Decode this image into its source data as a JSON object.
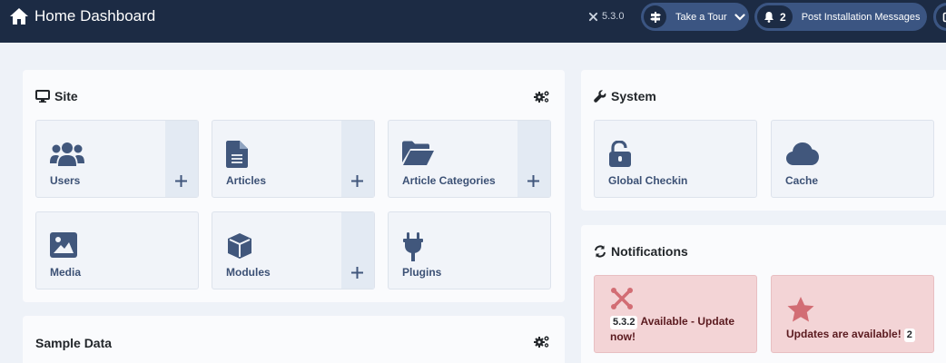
{
  "header": {
    "title": "Home Dashboard",
    "version": "5.3.0",
    "tour_label": "Take a Tour",
    "messages_count": "2",
    "messages_label": "Post Installation Messages"
  },
  "site": {
    "title": "Site",
    "tiles": [
      {
        "label": "Users",
        "icon": "users-icon",
        "has_add": true
      },
      {
        "label": "Articles",
        "icon": "file-icon",
        "has_add": true
      },
      {
        "label": "Article Categories",
        "icon": "folder-open-icon",
        "has_add": true
      },
      {
        "label": "Media",
        "icon": "image-icon",
        "has_add": false
      },
      {
        "label": "Modules",
        "icon": "cube-icon",
        "has_add": true
      },
      {
        "label": "Plugins",
        "icon": "plug-icon",
        "has_add": false
      }
    ]
  },
  "system": {
    "title": "System",
    "tiles": [
      {
        "label": "Global Checkin",
        "icon": "unlock-icon"
      },
      {
        "label": "Cache",
        "icon": "cloud-icon"
      }
    ]
  },
  "notifications": {
    "title": "Notifications",
    "joomla_version": "5.3.2",
    "joomla_text": "Available - Update now!",
    "updates_text": "Updates are available!",
    "updates_count": "2"
  },
  "sample_data": {
    "title": "Sample Data"
  },
  "colors": {
    "header_bg": "#1c2b44",
    "header_button": "#3b5582",
    "tile_label": "#3c5175",
    "notification_bg": "#f3d4d6",
    "notification_icon": "#d26d74"
  }
}
